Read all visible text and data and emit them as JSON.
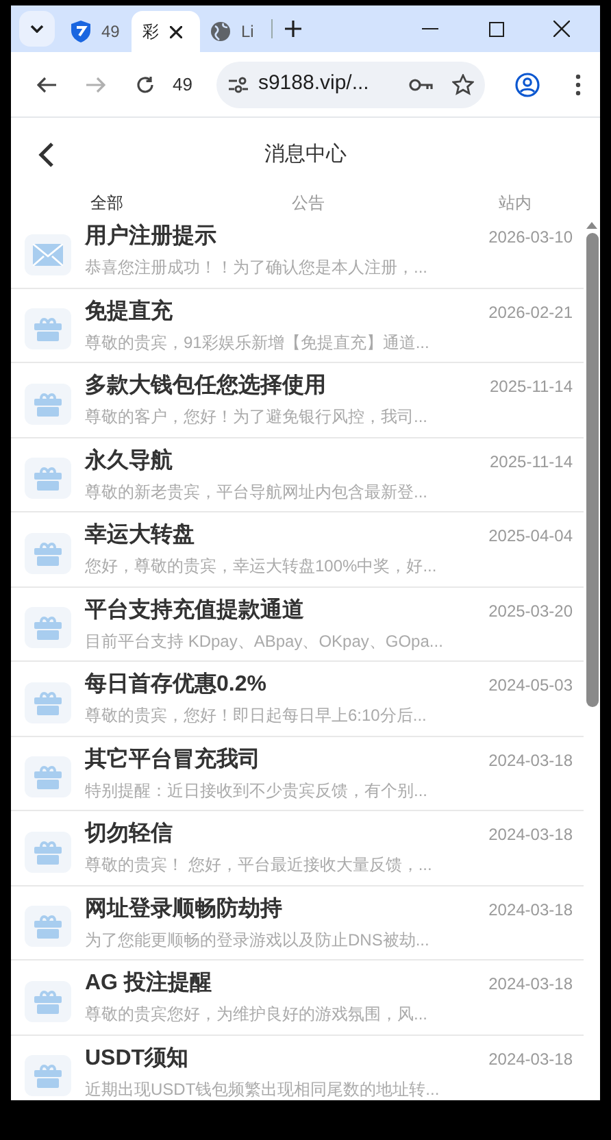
{
  "browser": {
    "tabs": [
      {
        "title": "49",
        "kind": "shield",
        "selected": false
      },
      {
        "title": "彩",
        "kind": "plain",
        "selected": true
      },
      {
        "title": "Li",
        "kind": "globe",
        "selected": false
      }
    ],
    "toolbar_text": "49",
    "address": "s9188.vip/..."
  },
  "page": {
    "title": "消息中心",
    "tabs": [
      {
        "label": "全部",
        "selected": true
      },
      {
        "label": "公告",
        "selected": false
      },
      {
        "label": "站内",
        "selected": false
      }
    ],
    "messages": [
      {
        "kind": "mail",
        "title": "用户注册提示",
        "date": "2026-03-10",
        "preview": "恭喜您注册成功！！为了确认您是本人注册，..."
      },
      {
        "kind": "gift",
        "title": "免提直充",
        "date": "2026-02-21",
        "preview": "尊敬的贵宾，91彩娱乐新增【免提直充】通道..."
      },
      {
        "kind": "gift",
        "title": "多款大钱包任您选择使用",
        "date": "2025-11-14",
        "preview": "尊敬的客户，您好！为了避免银行风控，我司..."
      },
      {
        "kind": "gift",
        "title": "永久导航",
        "date": "2025-11-14",
        "preview": "尊敬的新老贵宾，平台导航网址内包含最新登..."
      },
      {
        "kind": "gift",
        "title": "幸运大转盘",
        "date": "2025-04-04",
        "preview": "您好，尊敬的贵宾，幸运大转盘100%中奖，好..."
      },
      {
        "kind": "gift",
        "title": "平台支持充值提款通道",
        "date": "2025-03-20",
        "preview": "目前平台支持 KDpay、ABpay、OKpay、GOpa..."
      },
      {
        "kind": "gift",
        "title": "每日首存优惠0.2%",
        "date": "2024-05-03",
        "preview": "尊敬的贵宾，您好！即日起每日早上6:10分后..."
      },
      {
        "kind": "gift",
        "title": "其它平台冒充我司",
        "date": "2024-03-18",
        "preview": "特别提醒：近日接收到不少贵宾反馈，有个别..."
      },
      {
        "kind": "gift",
        "title": "切勿轻信",
        "date": "2024-03-18",
        "preview": "尊敬的贵宾！ 您好，平台最近接收大量反馈，..."
      },
      {
        "kind": "gift",
        "title": "网址登录顺畅防劫持",
        "date": "2024-03-18",
        "preview": "为了您能更顺畅的登录游戏以及防止DNS被劫..."
      },
      {
        "kind": "gift",
        "title": "AG 投注提醒",
        "date": "2024-03-18",
        "preview": "尊敬的贵宾您好，为维护良好的游戏氛围，风..."
      },
      {
        "kind": "gift",
        "title": "USDT须知",
        "date": "2024-03-18",
        "preview": "近期出现USDT钱包频繁出现相同尾数的地址转..."
      }
    ]
  }
}
